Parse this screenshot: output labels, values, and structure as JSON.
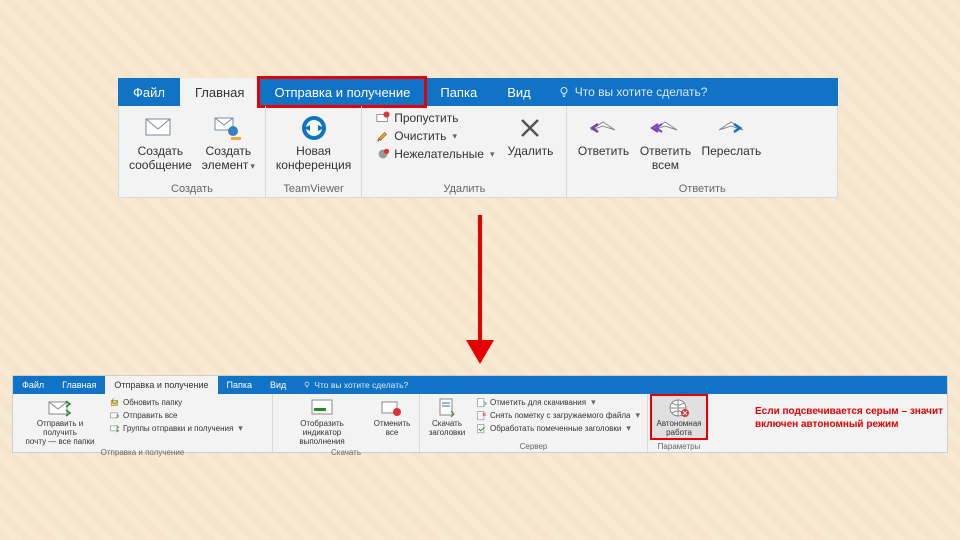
{
  "top": {
    "tabs": {
      "file": "Файл",
      "home": "Главная",
      "sendreceive": "Отправка и получение",
      "folder": "Папка",
      "view": "Вид"
    },
    "tellme": "Что вы хотите сделать?",
    "groups": {
      "create": {
        "label": "Создать",
        "new_mail": "Создать\nсообщение",
        "new_items": "Создать\nэлемент"
      },
      "teamviewer": {
        "label": "TeamViewer",
        "new_meeting": "Новая\nконференция"
      },
      "delete": {
        "label": "Удалить",
        "ignore": "Пропустить",
        "cleanup": "Очистить",
        "junk": "Нежелательные",
        "delete": "Удалить"
      },
      "respond": {
        "label": "Ответить",
        "reply": "Ответить",
        "reply_all": "Ответить\nвсем",
        "forward": "Переслать"
      }
    }
  },
  "bot": {
    "tabs": {
      "file": "Файл",
      "home": "Главная",
      "sendreceive": "Отправка и получение",
      "folder": "Папка",
      "view": "Вид"
    },
    "tellme": "Что вы хотите сделать?",
    "groups": {
      "sendreceive": {
        "label": "Отправка и получение",
        "send_all": "Отправить и получить\nпочту — все папки",
        "update_folder": "Обновить папку",
        "send_all_small": "Отправить все",
        "groups": "Группы отправки и получения"
      },
      "download": {
        "label": "Скачать",
        "progress": "Отобразить индикатор\nвыполнения",
        "cancel_all": "Отменить\nвсе"
      },
      "server": {
        "label": "Сервер",
        "download_headers": "Скачать\nзаголовки",
        "mark_download": "Отметить для скачивания",
        "unmark": "Снять пометку с загружаемого файла",
        "process_marked": "Обработать помеченные заголовки"
      },
      "prefs": {
        "label": "Параметры",
        "offline": "Автономная\nработа"
      }
    }
  },
  "annotation": "Если подсвечивается серым – значит включен автономный режим"
}
